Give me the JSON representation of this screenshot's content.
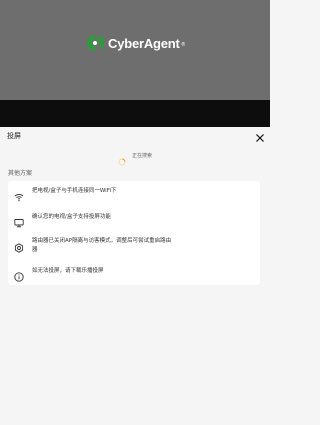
{
  "video": {
    "logo_text": "CyberAgent",
    "logo_reg": "®"
  },
  "sheet": {
    "title": "投屏",
    "close_icon": "close-icon",
    "searching_text": "正在搜索",
    "section_label": "其他方案",
    "tips": [
      {
        "icon": "wifi-icon",
        "text": "把电视/盒子与手机连接同一WiFi下"
      },
      {
        "icon": "monitor-icon",
        "text": "确认您的电视/盒子支持投屏功能"
      },
      {
        "icon": "settings-icon",
        "text": "路由器已关闭AP隔离与访客模式，调整后可尝试重启路由器"
      },
      {
        "icon": "info-icon",
        "text": "如无法投屏，请下载乐播投屏"
      }
    ]
  },
  "colors": {
    "logo_green": "#2f9a3e",
    "sheet_bg": "#f5f5f5",
    "card_bg": "#ffffff",
    "spinner": "#f0a030"
  }
}
